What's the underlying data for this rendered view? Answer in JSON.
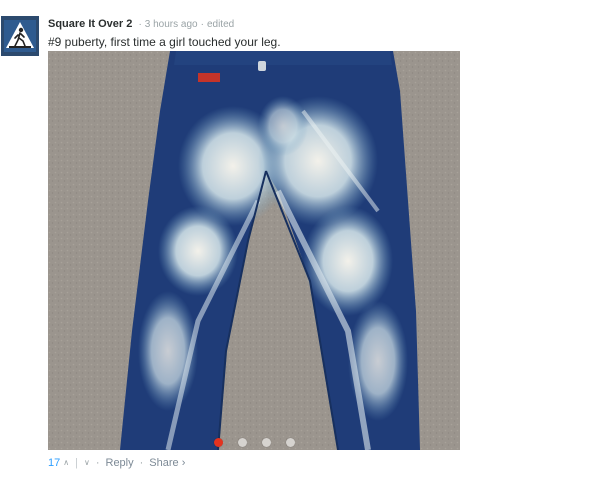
{
  "comment": {
    "author": "Square It Over 2",
    "timestamp": "3 hours ago",
    "edited": "edited",
    "text": "#9 puberty, first time a girl touched your leg.",
    "avatar_icon": "pedestrian-crossing-sign-icon",
    "media": {
      "description_icon": "bleached-jeans-photo",
      "slides_total": 4,
      "active_slide": 1
    },
    "footer": {
      "votes": "17",
      "upvote_icon": "caret-up-icon",
      "downvote_icon": "caret-down-icon",
      "reply": "Reply",
      "share": "Share ›"
    }
  },
  "colors": {
    "active_dot": "#e3331f",
    "vote_blue": "#2e9fff",
    "avatar_bg": "#2c4a6e"
  }
}
